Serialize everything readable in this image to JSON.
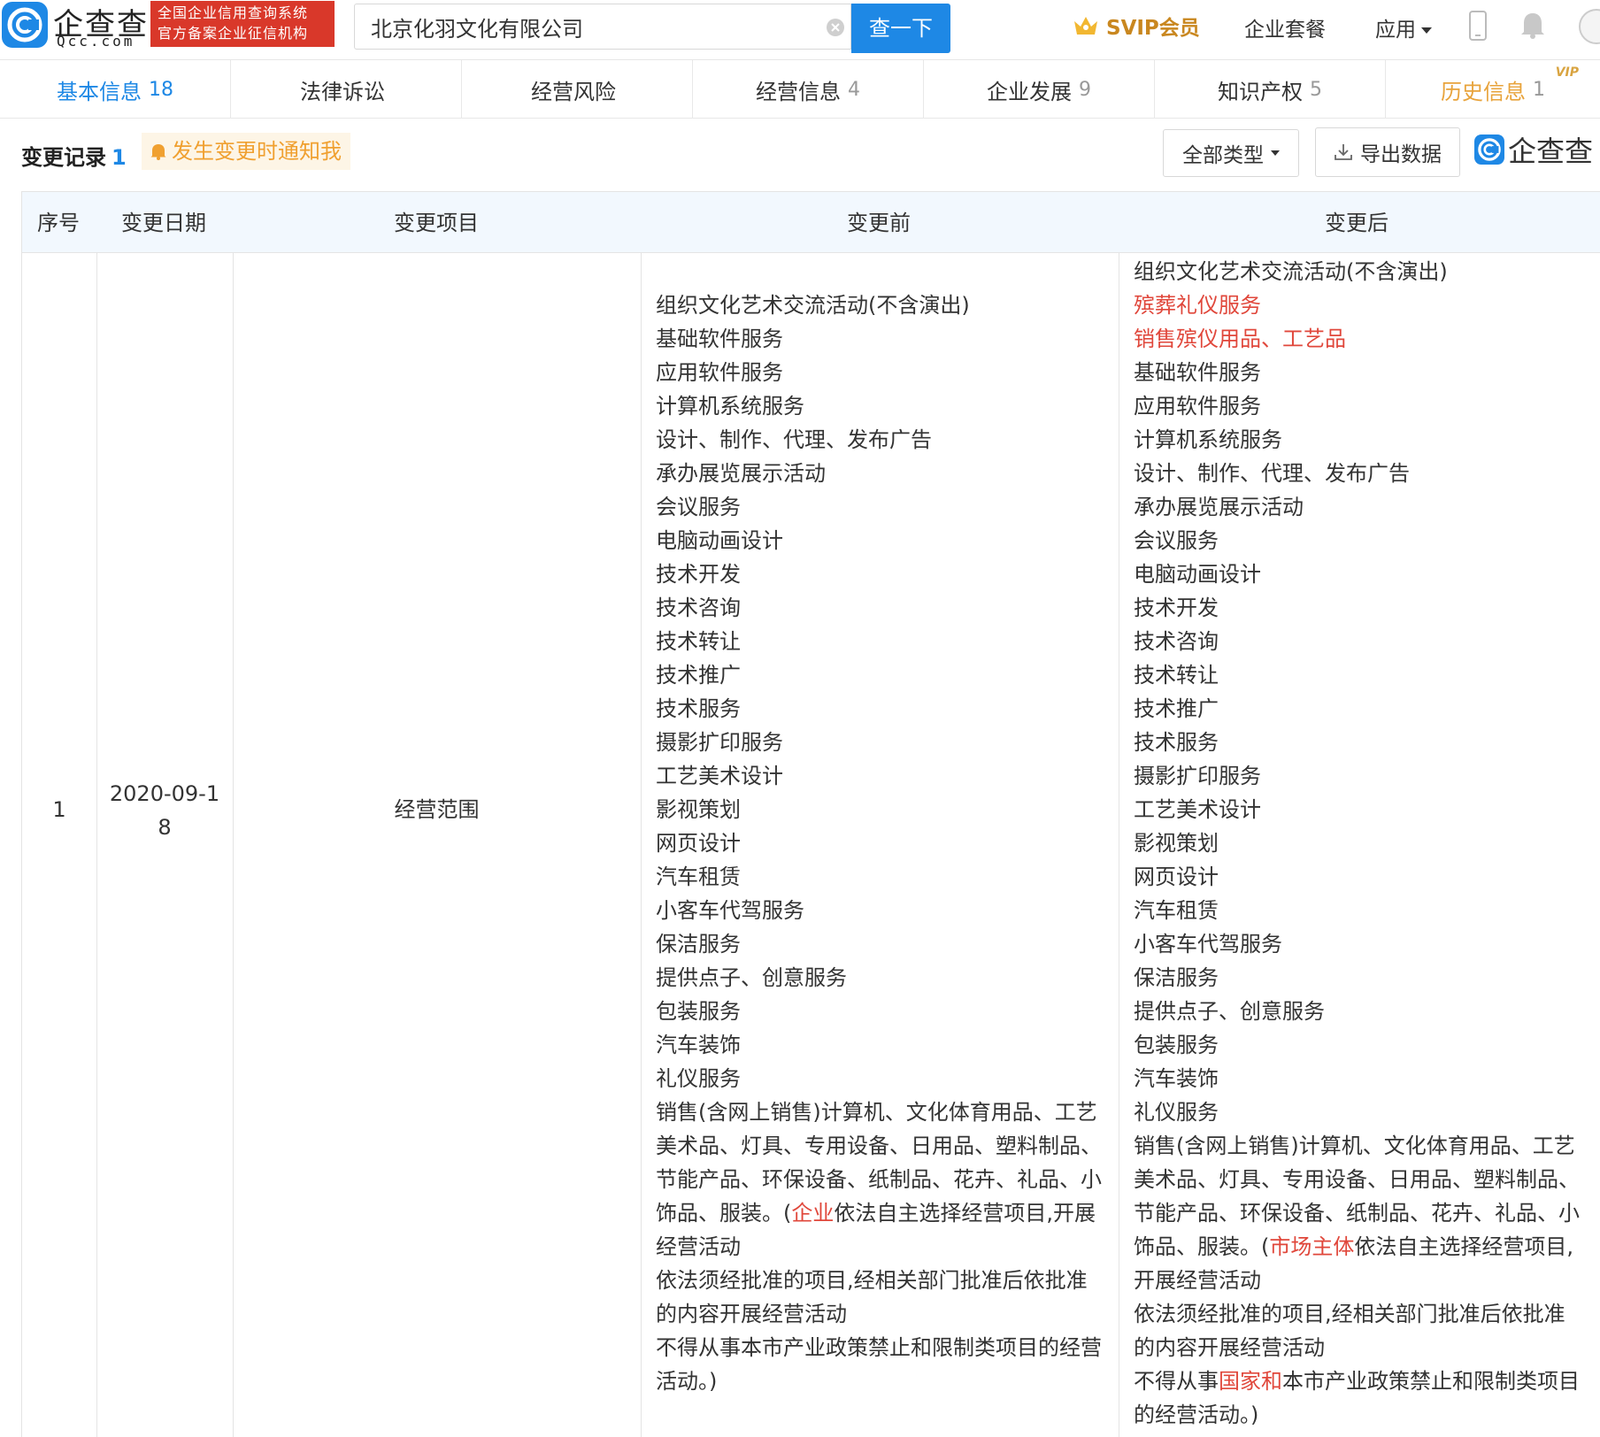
{
  "header": {
    "logo_text": "企查查",
    "logo_domain": "Qcc.com",
    "cert_line1": "全国企业信用查询系统",
    "cert_line2": "官方备案企业征信机构",
    "search_value": "北京化羽文化有限公司",
    "search_button": "查一下",
    "svip_label": "SVIP会员",
    "package_label": "企业套餐",
    "apps_label": "应用",
    "accent": "#1e88e5",
    "brand_red": "#d9382a",
    "vip_gold": "#c9871f"
  },
  "tabs": [
    {
      "label": "基本信息",
      "count": "18"
    },
    {
      "label": "法律诉讼",
      "count": ""
    },
    {
      "label": "经营风险",
      "count": ""
    },
    {
      "label": "经营信息",
      "count": "4"
    },
    {
      "label": "企业发展",
      "count": "9"
    },
    {
      "label": "知识产权",
      "count": "5"
    },
    {
      "label": "历史信息",
      "count": "1",
      "tag": "VIP"
    }
  ],
  "section": {
    "title": "变更记录",
    "count": "1",
    "notify_label": "发生变更时通知我",
    "type_filter": "全部类型",
    "export_label": "导出数据",
    "watermark": "企查查"
  },
  "table": {
    "headers": [
      "序号",
      "变更日期",
      "变更项目",
      "变更前",
      "变更后"
    ],
    "row": {
      "index": "1",
      "date_line1": "2020-09-1",
      "date_line2": "8",
      "item": "经营范围",
      "before": [
        {
          "t": "组织文化艺术交流活动(不含演出)"
        },
        {
          "t": "基础软件服务"
        },
        {
          "t": "应用软件服务"
        },
        {
          "t": "计算机系统服务"
        },
        {
          "t": "设计、制作、代理、发布广告"
        },
        {
          "t": "承办展览展示活动"
        },
        {
          "t": "会议服务"
        },
        {
          "t": "电脑动画设计"
        },
        {
          "t": "技术开发"
        },
        {
          "t": "技术咨询"
        },
        {
          "t": "技术转让"
        },
        {
          "t": "技术推广"
        },
        {
          "t": "技术服务"
        },
        {
          "t": "摄影扩印服务"
        },
        {
          "t": "工艺美术设计"
        },
        {
          "t": "影视策划"
        },
        {
          "t": "网页设计"
        },
        {
          "t": "汽车租赁"
        },
        {
          "t": "小客车代驾服务"
        },
        {
          "t": "保洁服务"
        },
        {
          "t": "提供点子、创意服务"
        },
        {
          "t": "包装服务"
        },
        {
          "t": "汽车装饰"
        },
        {
          "t": "礼仪服务"
        },
        {
          "t": "销售(含网上销售)计算机、文化体育用品、工艺"
        },
        {
          "t": "美术品、灯具、专用设备、日用品、塑料制品、"
        },
        {
          "t": "节能产品、环保设备、纸制品、花卉、礼品、小"
        },
        {
          "t": "饰品、服装。(",
          "red": "企业",
          "t2": "依法自主选择经营项目,开展"
        },
        {
          "t": "经营活动"
        },
        {
          "t": "依法须经批准的项目,经相关部门批准后依批准"
        },
        {
          "t": "的内容开展经营活动"
        },
        {
          "t": "不得从事本市产业政策禁止和限制类项目的经营"
        },
        {
          "t": "活动。)"
        }
      ],
      "after": [
        {
          "t": "组织文化艺术交流活动(不含演出)"
        },
        {
          "t": "",
          "red": "殡葬礼仪服务",
          "t2": ""
        },
        {
          "t": "",
          "red": "销售殡仪用品、工艺品",
          "t2": ""
        },
        {
          "t": "基础软件服务"
        },
        {
          "t": "应用软件服务"
        },
        {
          "t": "计算机系统服务"
        },
        {
          "t": "设计、制作、代理、发布广告"
        },
        {
          "t": "承办展览展示活动"
        },
        {
          "t": "会议服务"
        },
        {
          "t": "电脑动画设计"
        },
        {
          "t": "技术开发"
        },
        {
          "t": "技术咨询"
        },
        {
          "t": "技术转让"
        },
        {
          "t": "技术推广"
        },
        {
          "t": "技术服务"
        },
        {
          "t": "摄影扩印服务"
        },
        {
          "t": "工艺美术设计"
        },
        {
          "t": "影视策划"
        },
        {
          "t": "网页设计"
        },
        {
          "t": "汽车租赁"
        },
        {
          "t": "小客车代驾服务"
        },
        {
          "t": "保洁服务"
        },
        {
          "t": "提供点子、创意服务"
        },
        {
          "t": "包装服务"
        },
        {
          "t": "汽车装饰"
        },
        {
          "t": "礼仪服务"
        },
        {
          "t": "销售(含网上销售)计算机、文化体育用品、工艺"
        },
        {
          "t": "美术品、灯具、专用设备、日用品、塑料制品、"
        },
        {
          "t": "节能产品、环保设备、纸制品、花卉、礼品、小"
        },
        {
          "t": "饰品、服装。(",
          "red": "市场主体",
          "t2": "依法自主选择经营项目,"
        },
        {
          "t": "开展经营活动"
        },
        {
          "t": "依法须经批准的项目,经相关部门批准后依批准"
        },
        {
          "t": "的内容开展经营活动"
        },
        {
          "t": "不得从事",
          "red": "国家和",
          "t2": "本市产业政策禁止和限制类项目"
        },
        {
          "t": "的经营活动。)"
        }
      ]
    }
  }
}
